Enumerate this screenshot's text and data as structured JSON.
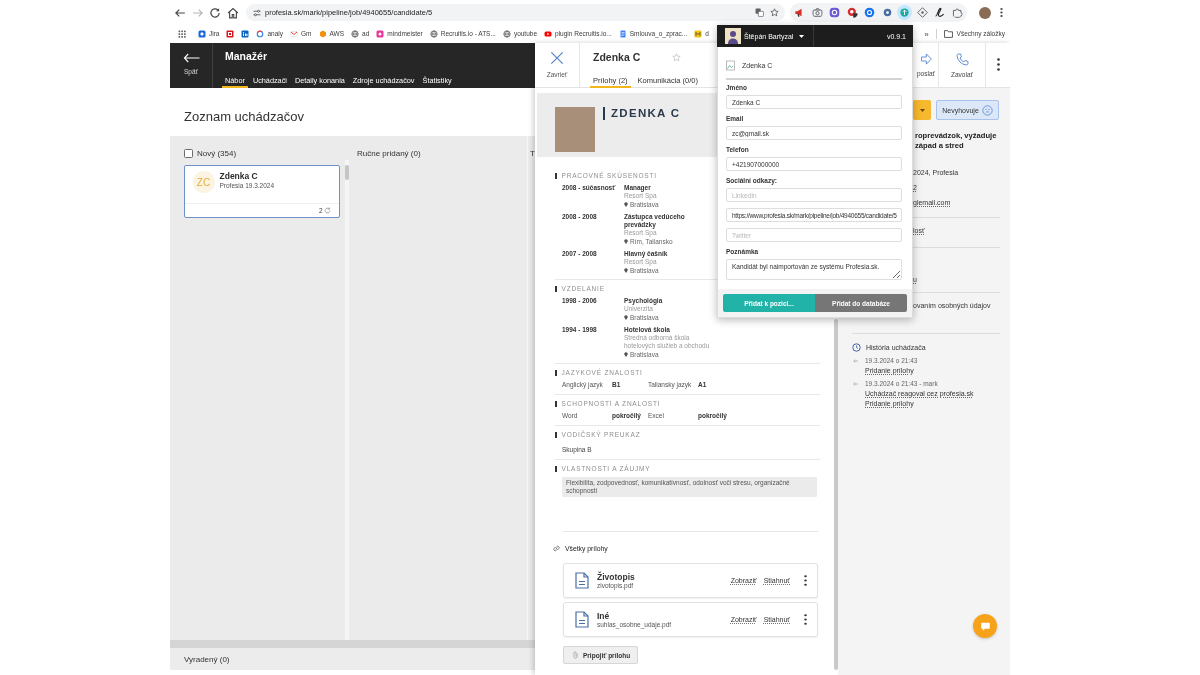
{
  "browser": {
    "url": "profesia.sk/mark/pipeline/job/4940655/candidate/5",
    "extensions": [
      {
        "selected": false
      },
      {
        "selected": false
      },
      {
        "selected": false
      },
      {
        "selected": false
      },
      {
        "selected": false
      },
      {
        "selected": false
      },
      {
        "selected": true
      },
      {
        "selected": false
      },
      {
        "selected": false
      },
      {
        "selected": false
      }
    ],
    "bookmarks": [
      {
        "kind": "labeled",
        "label": "Jira"
      },
      {
        "kind": "icon_only"
      },
      {
        "kind": "icon_only"
      },
      {
        "kind": "labeled",
        "label": "analy"
      },
      {
        "kind": "labeled",
        "label": "Gm"
      },
      {
        "kind": "labeled",
        "label": "AWS"
      },
      {
        "kind": "labeled",
        "label": "ad"
      },
      {
        "kind": "labeled",
        "label": "mindmeister"
      },
      {
        "kind": "labeled",
        "label": "Recruitis.io - ATS..."
      },
      {
        "kind": "labeled",
        "label": "youtube"
      },
      {
        "kind": "labeled",
        "label": "plugin Recruitis.io..."
      },
      {
        "kind": "labeled",
        "label": "Smlouva_o_zprac..."
      },
      {
        "kind": "labeled",
        "label": "d"
      }
    ],
    "more_bookmarks": "»",
    "all_bookmarks": "Všechny záložky"
  },
  "app": {
    "back_label": "Späť",
    "title": "Manažér",
    "tabs": [
      {
        "label": "Nábor",
        "selected": true
      },
      {
        "label": "Uchádzači",
        "selected": false
      },
      {
        "label": "Detaily konania",
        "selected": false
      },
      {
        "label": "Zdroje uchádzačov",
        "selected": false
      },
      {
        "label": "Štatistiky",
        "selected": false
      }
    ],
    "list_title": "Zoznam uchádzačov",
    "columns": [
      {
        "label": "Nový (354)",
        "checked": false,
        "cards": [
          {
            "initials": "ZC",
            "name": "Zdenka C",
            "source": "Profesia 19.3.2024",
            "count": "2",
            "selected": true
          }
        ]
      },
      {
        "label": "Ručne pridaný (0)"
      },
      {
        "label": "T"
      }
    ],
    "rejected_label": "Vyradený (0)"
  },
  "candidate": {
    "close_label": "Zavrieť",
    "name": "Zdenka C",
    "starred": false,
    "tabs": [
      {
        "label": "Prílohy (2)",
        "selected": true
      },
      {
        "label": "Komunikácia (0/0)",
        "selected": false
      }
    ],
    "actions": [
      {
        "kind": "forward",
        "label": "poslať"
      },
      {
        "kind": "call",
        "label": "Zavolať"
      },
      {
        "kind": "more"
      }
    ],
    "cv": {
      "name": "ZDENKA C",
      "sections": [
        {
          "kind": "entries",
          "title": "PRACOVNÉ SKÚSENOSTI",
          "entries": [
            {
              "period": "2008 - súčasnosť",
              "title": "Manager",
              "org": "Resort Spa",
              "place": "Bratislava"
            },
            {
              "period": "2008 - 2008",
              "title": "Zástupca vedúceho prevádzky",
              "org": "Resort Spa",
              "place": "Rím, Taliansko"
            },
            {
              "period": "2007 - 2008",
              "title": "Hlavný čašník",
              "org": "Resort Spa",
              "place": "Bratislava"
            }
          ]
        },
        {
          "kind": "entries",
          "title": "VZDELANIE",
          "entries": [
            {
              "period": "1998 - 2006",
              "title": "Psychológia",
              "org": "Univerzita",
              "place": "Bratislava"
            },
            {
              "period": "1994 - 1998",
              "title": "Hotelová škola",
              "org": "Stredná odborná škola hotelových služieb a obchodu",
              "place": "Bratislava"
            }
          ]
        },
        {
          "kind": "grid",
          "title": "JAZYKOVÉ ZNALOSTI",
          "items": [
            {
              "name": "Anglický jazyk",
              "grade": "B1"
            },
            {
              "name": "Taliansky jazyk",
              "grade": "A1"
            }
          ]
        },
        {
          "kind": "grid",
          "title": "SCHOPNOSTI A ZNALOSTI",
          "items": [
            {
              "name": "Word",
              "grade": "pokročilý"
            },
            {
              "name": "Excel",
              "grade": "pokročilý"
            }
          ]
        },
        {
          "kind": "text",
          "title": "VODIČSKÝ PREUKAZ",
          "text": "Skupina B"
        },
        {
          "kind": "tags",
          "title": "VLASTNOSTI A ZÁUJMY",
          "tags": [
            "Flexibilita, zodpovednosť, komunikatívnosť, odolnosť voči stresu, organizačné schopnosti"
          ]
        }
      ]
    },
    "attachments": {
      "title": "Všetky prílohy",
      "files": [
        {
          "type": "Životopis",
          "file": "zivotopis.pdf",
          "actions": [
            "Zobraziť",
            "Stiahnuť"
          ]
        },
        {
          "type": "Iné",
          "file": "suhlas_osobne_udaje.pdf",
          "actions": [
            "Zobraziť",
            "Stiahnuť"
          ]
        }
      ],
      "add_label": "Pripojiť prílohu"
    },
    "side": {
      "reject_label": "Nevyhovuje",
      "job_lines": [
        "roprevádzok, vyžaduje",
        "západ a stred"
      ],
      "groups": [
        {
          "items": [
            {
              "kind": "plain",
              "text": "2024, Profesia"
            },
            {
              "kind": "link",
              "text": "2"
            },
            {
              "kind": "link",
              "text": "glemail.com"
            }
          ]
        },
        {
          "items": [
            {
              "kind": "link",
              "text": "losť"
            }
          ]
        },
        {
          "items": [
            {
              "kind": "link",
              "text": "u"
            }
          ]
        },
        {
          "items": [
            {
              "kind": "plain",
              "text": "ovaním osobných údajov"
            }
          ]
        }
      ],
      "history": {
        "title": "História uchádzača",
        "events": [
          {
            "time": "19.3.2024 o 21:43",
            "lines": [
              "Pridanie prílohy"
            ]
          },
          {
            "time": "19.3.2024 o 21:43 - mark",
            "lines": [
              "Uchádzač reagoval cez profesia.sk",
              "Pridanie prílohy"
            ]
          }
        ]
      }
    }
  },
  "extension": {
    "user": "Štěpán Bartyzal",
    "version": "v0.9.1",
    "candidate": "Zdenka C",
    "fields": [
      {
        "kind": "input",
        "label": "Jméno",
        "inputs": [
          {
            "value": "Zdenka C"
          }
        ]
      },
      {
        "kind": "input",
        "label": "Email",
        "inputs": [
          {
            "value": "zc@gmail.sk"
          }
        ]
      },
      {
        "kind": "input",
        "label": "Telefon",
        "inputs": [
          {
            "value": "+421907000000"
          }
        ]
      },
      {
        "kind": "input",
        "label": "Sociální odkazy:",
        "inputs": [
          {
            "placeholder": "LinkedIn"
          },
          {
            "value": "https://www.profesia.sk/mark/pipeline/job/4940655/candidate/5"
          },
          {
            "placeholder": "Twitter"
          }
        ]
      },
      {
        "kind": "textarea",
        "label": "Poznámka",
        "inputs": [
          {
            "value": "Kandidát byl naimportován ze systému Profesia.sk."
          }
        ]
      }
    ],
    "buttons": [
      {
        "kind": "primary",
        "label": "Přidat k pozici..."
      },
      {
        "kind": "secondary",
        "label": "Přidat do databáze"
      }
    ]
  }
}
